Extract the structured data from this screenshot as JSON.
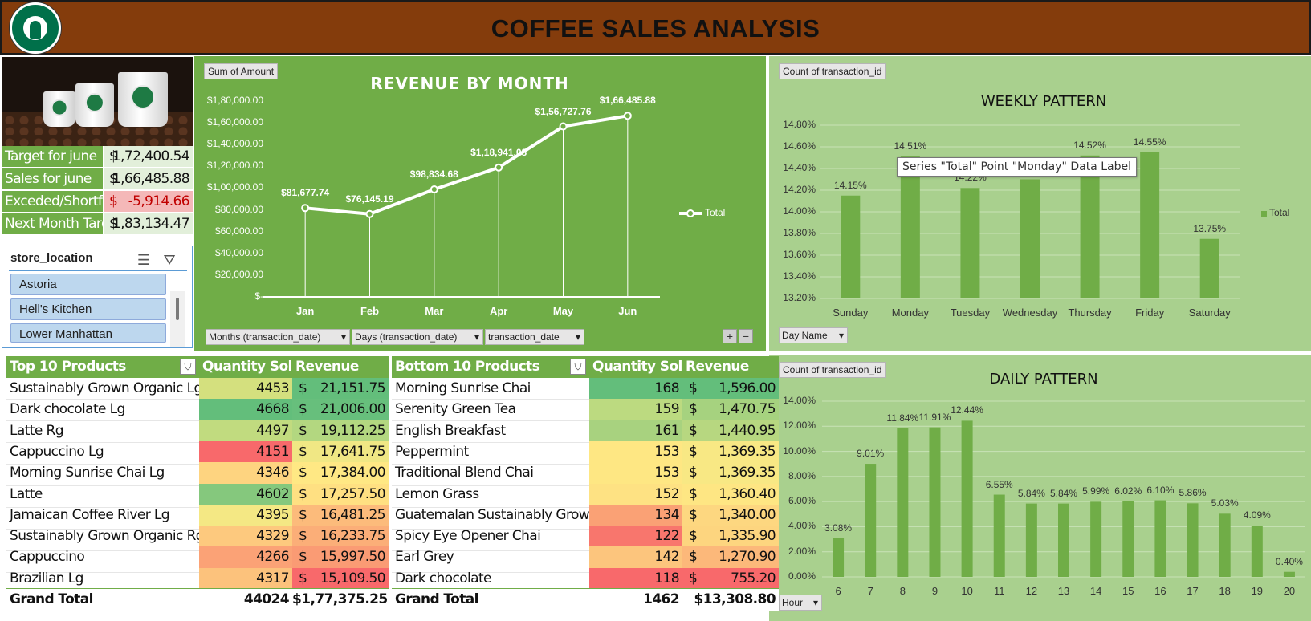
{
  "header": {
    "title": "COFFEE SALES ANALYSIS",
    "logo_icon": "starbucks-siren-logo"
  },
  "kpis": [
    {
      "label": "Target for june",
      "currency": "$",
      "value": "1,72,400.54",
      "status": "normal"
    },
    {
      "label": "Sales for june",
      "currency": "$",
      "value": "1,66,485.88",
      "status": "normal"
    },
    {
      "label": "Exceded/Shortfal",
      "currency": "$",
      "value": "-5,914.66",
      "status": "negative"
    },
    {
      "label": "Next Month Targ",
      "currency": "$",
      "value": "1,83,134.47",
      "status": "normal"
    }
  ],
  "slicer": {
    "title": "store_location",
    "items": [
      "Astoria",
      "Hell's Kitchen",
      "Lower Manhattan"
    ]
  },
  "revenue_chart": {
    "field_button": "Sum of Amount",
    "axis_buttons": [
      "Months (transaction_date)",
      "Days (transaction_date)",
      "transaction_date"
    ],
    "zoom_buttons": [
      "+",
      "−"
    ]
  },
  "weekly_chart": {
    "field_button": "Count of transaction_id",
    "axis_button": "Day Name"
  },
  "daily_chart": {
    "field_button": "Count of transaction_id",
    "axis_button": "Hour"
  },
  "tooltip": "Series \"Total\" Point \"Monday\" Data Label",
  "top_products": {
    "headers": [
      "Top 10 Products",
      "Quantity Sold",
      "Revenue"
    ],
    "rows": [
      {
        "name": "Sustainably Grown Organic Lg",
        "qty": "4453",
        "rev": "21,151.75",
        "qty_color": "#d4e07e",
        "rev_color": "#63be7b"
      },
      {
        "name": "Dark chocolate Lg",
        "qty": "4668",
        "rev": "21,006.00",
        "qty_color": "#63be7b",
        "rev_color": "#67bf7c"
      },
      {
        "name": "Latte Rg",
        "qty": "4497",
        "rev": "19,112.25",
        "qty_color": "#c1db7f",
        "rev_color": "#b3d780"
      },
      {
        "name": "Cappuccino Lg",
        "qty": "4151",
        "rev": "17,641.75",
        "qty_color": "#f8696b",
        "rev_color": "#f0e784"
      },
      {
        "name": "Morning Sunrise Chai Lg",
        "qty": "4346",
        "rev": "17,384.00",
        "qty_color": "#fed480",
        "rev_color": "#ffe884"
      },
      {
        "name": "Latte",
        "qty": "4602",
        "rev": "17,257.50",
        "qty_color": "#85c87d",
        "rev_color": "#ffe082"
      },
      {
        "name": "Jamaican Coffee River Lg",
        "qty": "4395",
        "rev": "16,481.25",
        "qty_color": "#f4e884",
        "rev_color": "#fcbb7b"
      },
      {
        "name": "Sustainably Grown Organic Rg",
        "qty": "4329",
        "rev": "16,233.75",
        "qty_color": "#fdc97e",
        "rev_color": "#fbae78"
      },
      {
        "name": "Cappuccino",
        "qty": "4266",
        "rev": "15,997.50",
        "qty_color": "#fba276",
        "rev_color": "#fa9b74"
      },
      {
        "name": "Brazilian Lg",
        "qty": "4317",
        "rev": "15,109.50",
        "qty_color": "#fcc27c",
        "rev_color": "#f8696b"
      }
    ],
    "total": {
      "label": "Grand Total",
      "qty": "44024",
      "rev": "$1,77,375.25"
    }
  },
  "bottom_products": {
    "headers": [
      "Bottom 10 Products",
      "Quantity Sold",
      "Revenue"
    ],
    "rows": [
      {
        "name": "Morning Sunrise Chai",
        "qty": "168",
        "rev": "1,596.00",
        "qty_color": "#63be7b",
        "rev_color": "#63be7b"
      },
      {
        "name": "Serenity Green Tea",
        "qty": "159",
        "rev": "1,470.75",
        "qty_color": "#bcda80",
        "rev_color": "#a6d27f"
      },
      {
        "name": "English Breakfast",
        "qty": "161",
        "rev": "1,440.95",
        "qty_color": "#a8d27f",
        "rev_color": "#b7d780"
      },
      {
        "name": "Peppermint",
        "qty": "153",
        "rev": "1,369.35",
        "qty_color": "#fee783",
        "rev_color": "#f8e884"
      },
      {
        "name": "Traditional Blend Chai",
        "qty": "153",
        "rev": "1,369.35",
        "qty_color": "#fee783",
        "rev_color": "#f8e884"
      },
      {
        "name": "Lemon Grass",
        "qty": "152",
        "rev": "1,360.40",
        "qty_color": "#fee283",
        "rev_color": "#fee683"
      },
      {
        "name": "Guatemalan Sustainably Grown",
        "qty": "134",
        "rev": "1,340.00",
        "qty_color": "#faa175",
        "rev_color": "#fdd780"
      },
      {
        "name": "Spicy Eye Opener Chai",
        "qty": "122",
        "rev": "1,335.90",
        "qty_color": "#f8766d",
        "rev_color": "#fdd57f"
      },
      {
        "name": "Earl Grey",
        "qty": "142",
        "rev": "1,270.90",
        "qty_color": "#fcc57d",
        "rev_color": "#fcb87a"
      },
      {
        "name": "Dark chocolate",
        "qty": "118",
        "rev": "755.20",
        "qty_color": "#f8696b",
        "rev_color": "#f8696b"
      }
    ],
    "total": {
      "label": "Grand Total",
      "qty": "1462",
      "rev": "$13,308.80"
    }
  },
  "chart_data": [
    {
      "type": "line",
      "title": "REVENUE BY MONTH",
      "categories": [
        "Jan",
        "Feb",
        "Mar",
        "Apr",
        "May",
        "Jun"
      ],
      "series": [
        {
          "name": "Total",
          "values": [
            81677.74,
            76145.19,
            98834.68,
            118941.08,
            156727.76,
            166485.88
          ]
        }
      ],
      "data_labels": [
        "$81,677.74",
        "$76,145.19",
        "$98,834.68",
        "$1,18,941.08",
        "$1,56,727.76",
        "$1,66,485.88"
      ],
      "ylim": [
        0,
        180000
      ],
      "yticks": [
        "$-",
        "$20,000.00",
        "$40,000.00",
        "$60,000.00",
        "$80,000.00",
        "$1,00,000.00",
        "$1,20,000.00",
        "$1,40,000.00",
        "$1,60,000.00",
        "$1,80,000.00"
      ],
      "legend": "right"
    },
    {
      "type": "bar",
      "title": "WEEKLY PATTERN",
      "categories": [
        "Sunday",
        "Monday",
        "Tuesday",
        "Wednesday",
        "Thursday",
        "Friday",
        "Saturday"
      ],
      "series": [
        {
          "name": "Total",
          "values": [
            14.15,
            14.51,
            14.22,
            14.3,
            14.52,
            14.55,
            13.75
          ]
        }
      ],
      "data_labels": [
        "14.15%",
        "14.51%",
        "14.22%",
        "",
        "14.52%",
        "14.55%",
        "13.75%"
      ],
      "ylim": [
        13.2,
        14.8
      ],
      "yticks": [
        "13.20%",
        "13.40%",
        "13.60%",
        "13.80%",
        "14.00%",
        "14.20%",
        "14.40%",
        "14.60%",
        "14.80%"
      ],
      "grid": true,
      "legend": "right"
    },
    {
      "type": "bar",
      "title": "DAILY PATTERN",
      "categories": [
        "6",
        "7",
        "8",
        "9",
        "10",
        "11",
        "12",
        "13",
        "14",
        "15",
        "16",
        "17",
        "18",
        "19",
        "20"
      ],
      "series": [
        {
          "values": [
            3.08,
            9.01,
            11.84,
            11.91,
            12.44,
            6.55,
            5.84,
            5.84,
            5.99,
            6.02,
            6.1,
            5.86,
            5.03,
            4.09,
            0.4
          ]
        }
      ],
      "data_labels": [
        "3.08%",
        "9.01%",
        "11.84%",
        "11.91%",
        "12.44%",
        "6.55%",
        "5.84%",
        "5.84%",
        "5.99%",
        "6.02%",
        "6.10%",
        "5.86%",
        "5.03%",
        "4.09%",
        "0.40%"
      ],
      "ylim": [
        0,
        14
      ],
      "yticks": [
        "0.00%",
        "2.00%",
        "4.00%",
        "6.00%",
        "8.00%",
        "10.00%",
        "12.00%",
        "14.00%"
      ],
      "grid": true
    }
  ]
}
